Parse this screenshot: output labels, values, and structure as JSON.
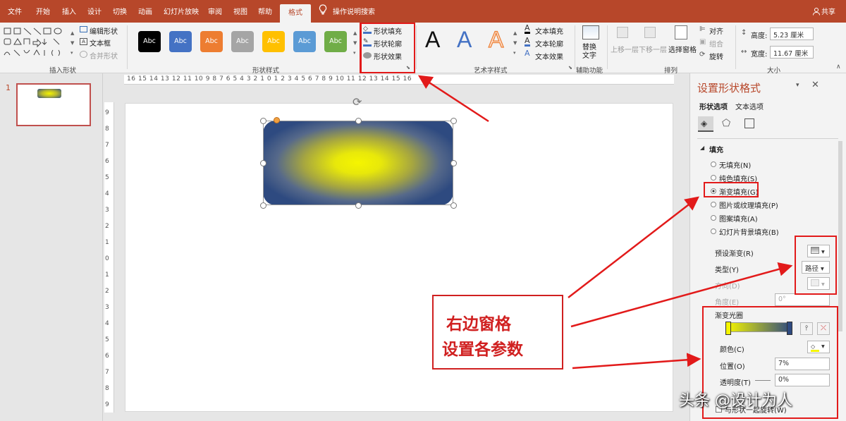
{
  "tabs": [
    "文件",
    "开始",
    "插入",
    "设计",
    "切换",
    "动画",
    "幻灯片放映",
    "审阅",
    "视图",
    "帮助",
    "格式"
  ],
  "tell_me": "操作说明搜索",
  "share": "共享",
  "ribbon": {
    "insert_shapes_label": "插入形状",
    "edit_shape": "编辑形状",
    "text_box": "文本框",
    "merge_shapes": "合并形状",
    "shape_styles_label": "形状样式",
    "swatch_text": "Abc",
    "swatch_colors": [
      "#000000",
      "#4472c4",
      "#ed7d31",
      "#a5a5a5",
      "#ffc000",
      "#5b9bd5",
      "#70ad47"
    ],
    "shape_fill": "形状填充",
    "shape_outline": "形状轮廓",
    "shape_effects": "形状效果",
    "wordart_label": "艺术字样式",
    "wordart_letter": "A",
    "text_fill": "文本填充",
    "text_outline": "文本轮廓",
    "text_effects": "文本效果",
    "alt_text": "替换文字",
    "accessibility_label": "辅助功能",
    "align": "对齐",
    "group": "组合",
    "rotate": "旋转",
    "bring_forward": "上移一层",
    "send_backward": "下移一层",
    "selection_pane": "选择窗格",
    "arrange_label": "排列",
    "height_label": "高度:",
    "height_value": "5.23 厘米",
    "width_label": "宽度:",
    "width_value": "11.67 厘米",
    "size_label": "大小"
  },
  "ruler_h": "16 15 14 13 12 11 10 9 8 7 6 5 4 3 2 1 0 1 2 3 4 5 6 7 8 9 10 11 12 13 14 15 16",
  "ruler_v": "9 8 7 6 5 4 3 2 1 0 1 2 3 4 5 6 7 8 9",
  "slide_number": "1",
  "panel": {
    "title": "设置形状格式",
    "tab_shape": "形状选项",
    "tab_text": "文本选项",
    "section_fill": "填充",
    "fill_options": [
      "无填充(N)",
      "纯色填充(S)",
      "渐变填充(G)",
      "图片或纹理填充(P)",
      "图案填充(A)",
      "幻灯片背景填充(B)"
    ],
    "selected_fill": 2,
    "preset_label": "预设渐变(R)",
    "type_label": "类型(Y)",
    "type_value": "路径",
    "direction_label": "方向(D)",
    "angle_label": "角度(E)",
    "angle_value": "0°",
    "stops_label": "渐变光圈",
    "color_label": "颜色(C)",
    "position_label": "位置(O)",
    "position_value": "7%",
    "transparency_label": "透明度(T)",
    "transparency_value": "0%",
    "rotate_with_shape": "与形状一起旋转(W)"
  },
  "annotation": {
    "line1": "右边窗格",
    "line2": "设置各参数"
  },
  "watermark": "头条 @设计为人",
  "colors": {
    "accent": "#b7472a",
    "annotation_red": "#e21a1a",
    "gradient_center": "#f5f500",
    "gradient_edge": "#2e4a80"
  }
}
